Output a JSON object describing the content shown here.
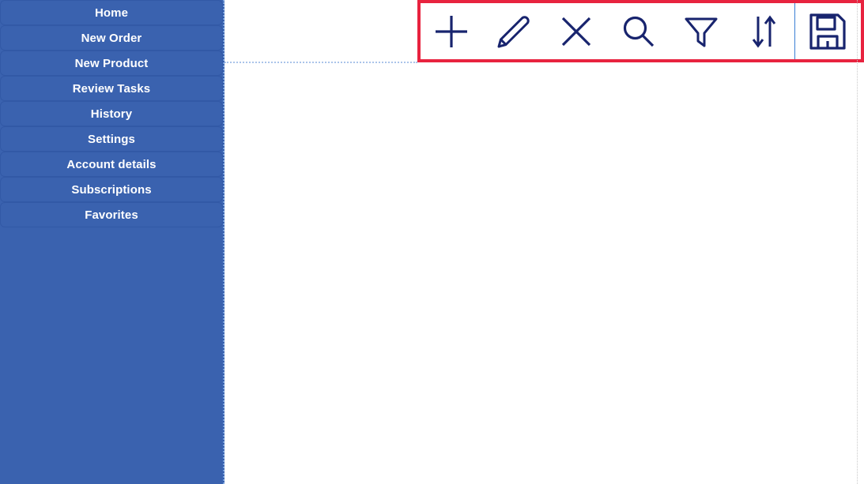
{
  "colors": {
    "sidebar_bg": "#3a62af",
    "sidebar_item_border": "#3259a6",
    "sidebar_text": "#ffffff",
    "sidebar_edge_dotted": "#7ba3dd",
    "icon_navy": "#18246e",
    "highlight_red": "#e8233f",
    "divider_dotted": "#aac4ea",
    "separator_blue": "#3a7fd5",
    "page_bg": "#ffffff"
  },
  "sidebar": {
    "items": [
      {
        "label": "Home",
        "name": "home"
      },
      {
        "label": "New Order",
        "name": "new-order"
      },
      {
        "label": "New Product",
        "name": "new-product"
      },
      {
        "label": "Review Tasks",
        "name": "review-tasks"
      },
      {
        "label": "History",
        "name": "history"
      },
      {
        "label": "Settings",
        "name": "settings"
      },
      {
        "label": "Account details",
        "name": "account-details"
      },
      {
        "label": "Subscriptions",
        "name": "subscriptions"
      },
      {
        "label": "Favorites",
        "name": "favorites"
      }
    ]
  },
  "toolbar": {
    "highlighted": true,
    "buttons": [
      {
        "icon": "plus-icon",
        "label": "Add"
      },
      {
        "icon": "pencil-icon",
        "label": "Edit"
      },
      {
        "icon": "close-x-icon",
        "label": "Delete"
      },
      {
        "icon": "search-icon",
        "label": "Search"
      },
      {
        "icon": "filter-funnel-icon",
        "label": "Filter"
      },
      {
        "icon": "sort-arrows-icon",
        "label": "Sort"
      }
    ],
    "save_button": {
      "icon": "save-floppy-icon",
      "label": "Save"
    }
  },
  "content": {
    "body_text": ""
  }
}
